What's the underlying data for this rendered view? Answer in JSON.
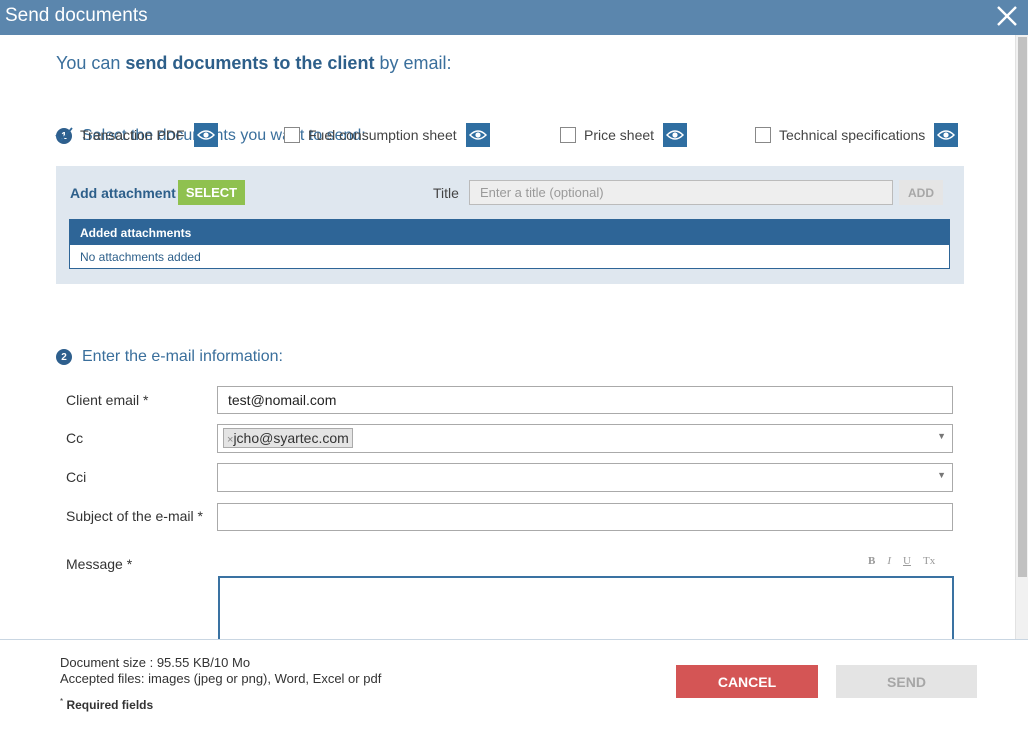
{
  "dialog": {
    "title": "Send documents"
  },
  "intro": {
    "prefix": "You can ",
    "bold": "send documents to the client",
    "suffix": " by email:"
  },
  "step1": {
    "number": "1",
    "label": "Select the documents you want to send:"
  },
  "documents": [
    {
      "label": "Transaction PDF",
      "checked": true,
      "icon": "eye-icon"
    },
    {
      "label": "Fuel consumption sheet",
      "checked": false,
      "icon": "eye-icon"
    },
    {
      "label": "Price sheet",
      "checked": false,
      "icon": "eye-icon"
    },
    {
      "label": "Technical specifications",
      "checked": false,
      "icon": "eye-icon"
    }
  ],
  "attachments": {
    "add_label": "Add attachment",
    "select_button": "SELECT",
    "title_label": "Title",
    "title_placeholder": "Enter a title (optional)",
    "add_button": "ADD",
    "table_header": "Added attachments",
    "empty_text": "No attachments added"
  },
  "step2": {
    "number": "2",
    "label": "Enter the e-mail information:"
  },
  "form": {
    "client_email_label": "Client email *",
    "client_email_value": "test@nomail.com",
    "cc_label": "Cc",
    "cc_tags": [
      "jcho@syartec.com"
    ],
    "cci_label": "Cci",
    "subject_label": "Subject of the e-mail *",
    "subject_value": "",
    "message_label": "Message *",
    "toolbar": [
      "B",
      "I",
      "U",
      "Tx"
    ]
  },
  "footer": {
    "document_size": "Document size : 95.55 KB/10 Mo",
    "accepted_files": "Accepted files: images (jpeg or png), Word, Excel or pdf",
    "required_marker": "*",
    "required_text": "Required fields",
    "cancel_button": "CANCEL",
    "send_button": "SEND"
  },
  "colors": {
    "titlebar": "#5b86ad",
    "accent": "#2e6597",
    "select": "#8fc14f",
    "cancel": "#d45555"
  }
}
